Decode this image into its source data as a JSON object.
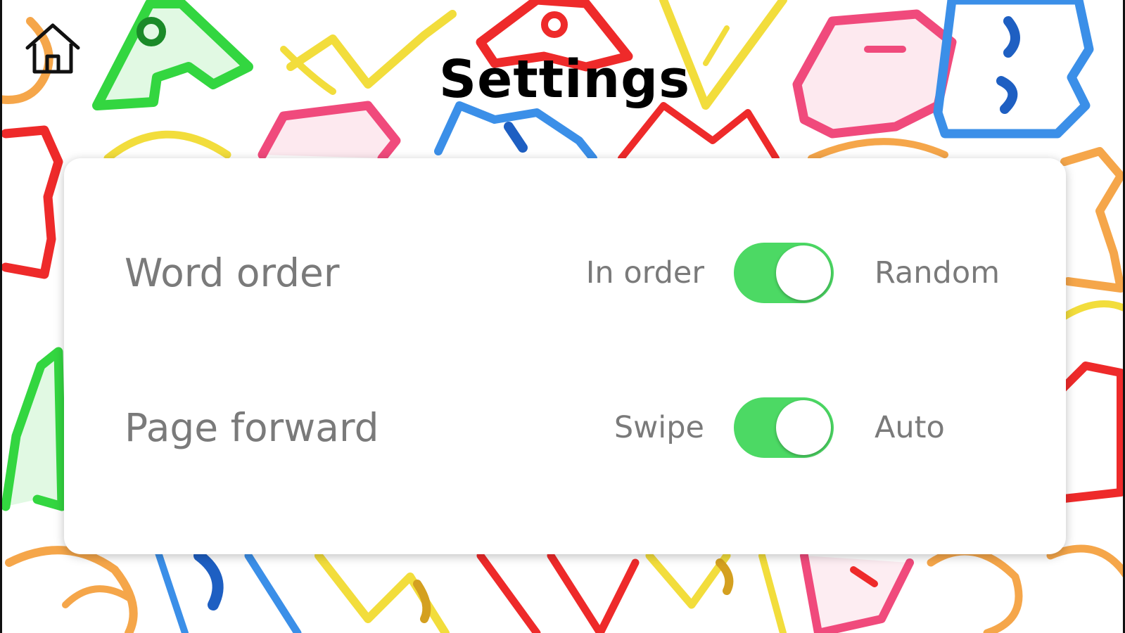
{
  "header": {
    "title": "Settings",
    "home_icon": "home-icon"
  },
  "settings": [
    {
      "label": "Word order",
      "option_off": "In order",
      "option_on": "Random",
      "toggle_on": true
    },
    {
      "label": "Page forward",
      "option_off": "Swipe",
      "option_on": "Auto",
      "toggle_on": true
    }
  ],
  "colors": {
    "toggle_on": "#4cd964",
    "label_text": "#7a7a7a",
    "title_text": "#000000"
  }
}
